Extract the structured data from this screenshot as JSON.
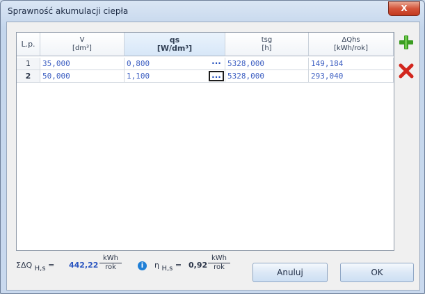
{
  "window": {
    "title": "Sprawność akumulacji ciepła",
    "close_label": "X"
  },
  "grid": {
    "columns": [
      {
        "line1": "L.p.",
        "line2": ""
      },
      {
        "line1": "V",
        "line2": "[dm³]"
      },
      {
        "line1": "qs",
        "line2": "[W/dm³]"
      },
      {
        "line1": "tsg",
        "line2": "[h]"
      },
      {
        "line1": "ΔQhs",
        "line2": "[kWh/rok]"
      }
    ],
    "rows": [
      {
        "lp": "1",
        "v": "35,000",
        "qs": "0,800",
        "dots": "...",
        "tsg": "5328,000",
        "dqhs": "149,184"
      },
      {
        "lp": "2",
        "v": "50,000",
        "qs": "1,100",
        "dots": "...",
        "tsg": "5328,000",
        "dqhs": "293,040"
      }
    ],
    "selected_row": 2
  },
  "side": {
    "add_icon": "plus-icon",
    "delete_icon": "x-icon"
  },
  "summary": {
    "sum_symbol": "ΣΔQ",
    "sum_sub": "H,s",
    "sum_value": "442,22",
    "sum_unit_num": "kWh",
    "sum_unit_den": "rok",
    "eff_symbol": "η",
    "eff_sub": "H,s",
    "eff_value": "0,92",
    "eff_unit_num": "kWh",
    "eff_unit_den": "rok",
    "equals": "=",
    "info_glyph": "i"
  },
  "buttons": {
    "cancel": "Anuluj",
    "ok": "OK"
  },
  "colors": {
    "accent_blue": "#2a55c0",
    "add_green": "#3b9d21",
    "delete_red": "#d2261d"
  }
}
